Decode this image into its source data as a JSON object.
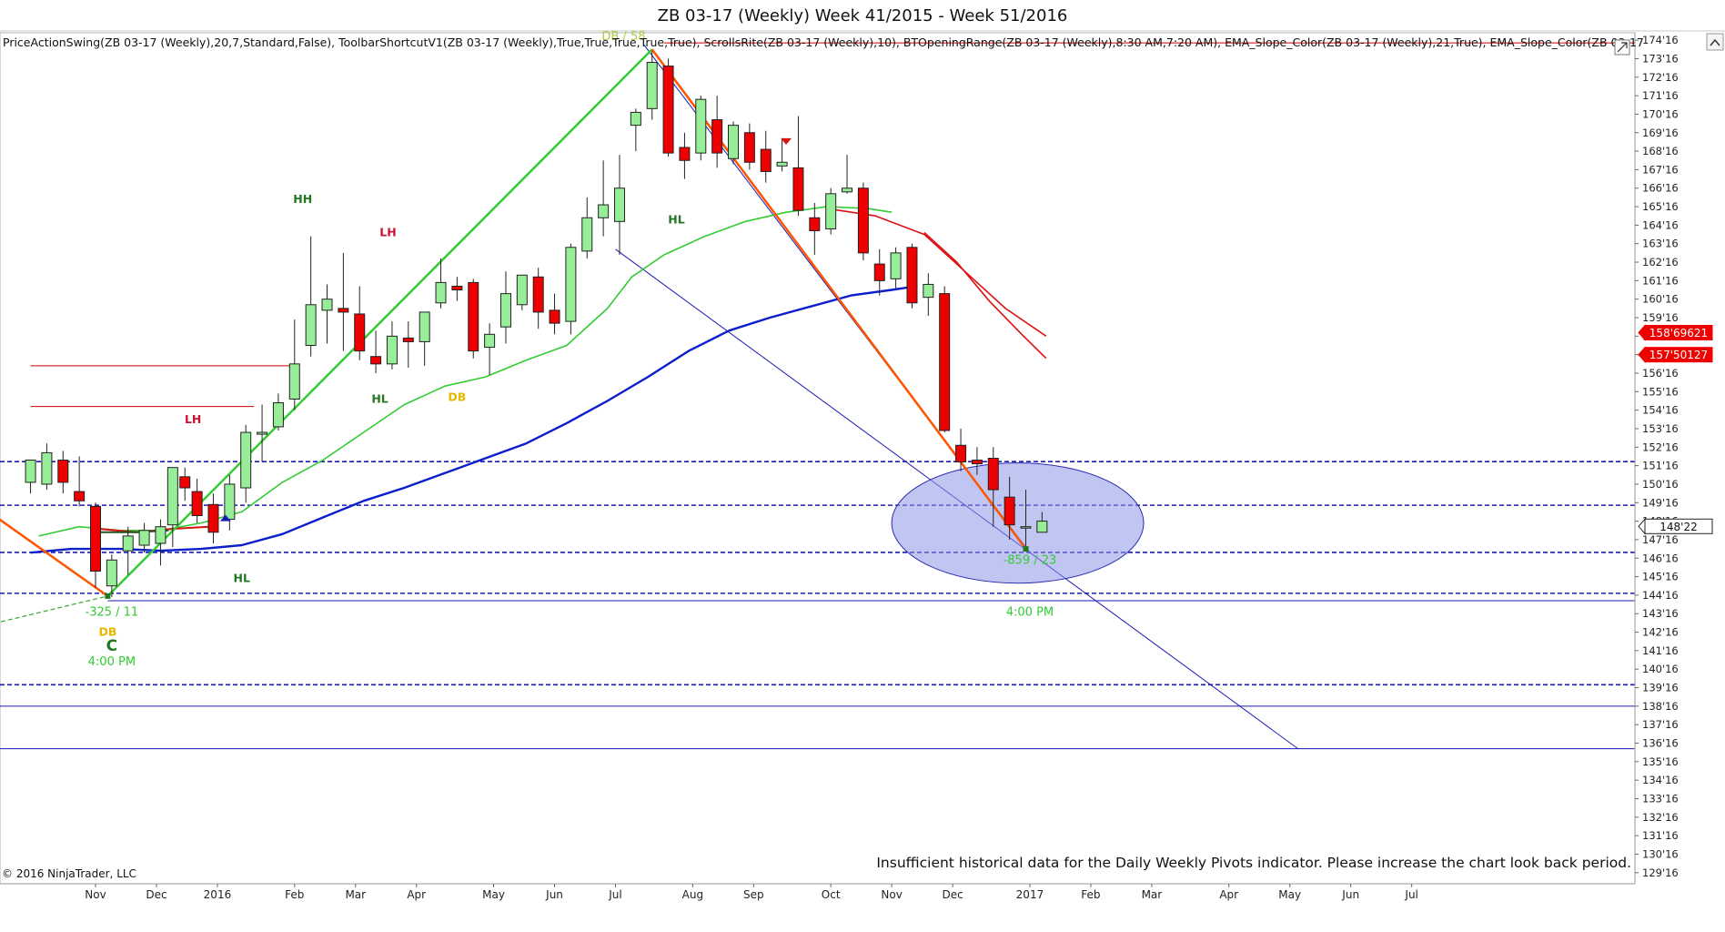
{
  "window": {
    "title": "ZB 03-17 (Weekly)  Week 41/2015 - Week 51/2016",
    "indicators_line": "PriceActionSwing(ZB 03-17 (Weekly),20,7,Standard,False), ToolbarShortcutV1(ZB 03-17 (Weekly),True,True,True,True,True), ScrollsRite(ZB 03-17 (Weekly),10), BTOpeningRange(ZB 03-17 (Weekly),8:30 AM,7:20 AM), EMA_Slope_Color(ZB 03-17 (Weekly),21,True), EMA_Slope_Color(ZB 03-17",
    "copyright": "© 2016 NinjaTrader, LLC",
    "warning": "Insufficient historical data for the Daily Weekly Pivots indicator. Please increase the chart look back period."
  },
  "colors": {
    "bull_candle": "#98ee98",
    "bear_candle": "#ee0000",
    "ema_fast": "#33cc33",
    "ema_slow": "#0a1ecc",
    "ema_red": "#dd1111",
    "swing_up": "#33cc33",
    "swing_down": "#ff5500",
    "levels": "#1a1ab4",
    "ellipse_fill": "#8c96e6"
  },
  "chart_data": {
    "type": "candlestick",
    "title": "ZB 03-17 (Weekly)  Week 41/2015 - Week 51/2016",
    "y_ticks": [
      "174'16",
      "173'16",
      "172'16",
      "171'16",
      "170'16",
      "169'16",
      "168'16",
      "167'16",
      "166'16",
      "165'16",
      "164'16",
      "163'16",
      "162'16",
      "161'16",
      "160'16",
      "159'16",
      "158'16",
      "157'16",
      "156'16",
      "155'16",
      "154'16",
      "153'16",
      "152'16",
      "151'16",
      "150'16",
      "149'16",
      "148'16",
      "147'16",
      "146'16",
      "145'16",
      "144'16",
      "143'16",
      "142'16",
      "141'16",
      "140'16",
      "139'16",
      "138'16",
      "137'16",
      "136'16",
      "135'16",
      "134'16",
      "133'16",
      "132'16",
      "131'16",
      "130'16",
      "129'16"
    ],
    "y_range": [
      128.9,
      174.9
    ],
    "x_ticks": [
      {
        "label": "Nov",
        "x": 0
      },
      {
        "label": "Dec",
        "x": 0.75
      },
      {
        "label": "2016",
        "x": 1.5
      },
      {
        "label": "Feb",
        "x": 2.45
      },
      {
        "label": "Mar",
        "x": 3.2
      },
      {
        "label": "Apr",
        "x": 3.95
      },
      {
        "label": "May",
        "x": 4.9
      },
      {
        "label": "Jun",
        "x": 5.65
      },
      {
        "label": "Jul",
        "x": 6.4
      },
      {
        "label": "Aug",
        "x": 7.35
      },
      {
        "label": "Sep",
        "x": 8.1
      },
      {
        "label": "Oct",
        "x": 9.05
      },
      {
        "label": "Nov",
        "x": 9.8
      },
      {
        "label": "Dec",
        "x": 10.55
      },
      {
        "label": "2017",
        "x": 11.5
      },
      {
        "label": "Feb",
        "x": 12.25
      },
      {
        "label": "Mar",
        "x": 13.0
      },
      {
        "label": "Apr",
        "x": 13.95
      },
      {
        "label": "May",
        "x": 14.7
      },
      {
        "label": "Jun",
        "x": 15.45
      },
      {
        "label": "Jul",
        "x": 16.2
      }
    ],
    "x_unit": "months from Nov 2015",
    "candles": [
      {
        "x": -0.8,
        "o": 150.6,
        "h": 151.3,
        "c": 151.8,
        "l": 150.0
      },
      {
        "x": -0.6,
        "o": 150.5,
        "h": 152.7,
        "c": 152.2,
        "l": 150.2
      },
      {
        "x": -0.4,
        "o": 151.8,
        "h": 152.3,
        "c": 150.6,
        "l": 150.0
      },
      {
        "x": -0.2,
        "o": 150.1,
        "h": 152.0,
        "c": 149.6,
        "l": 149.3
      },
      {
        "x": 0.0,
        "o": 149.3,
        "h": 149.5,
        "c": 145.8,
        "l": 144.9
      },
      {
        "x": 0.2,
        "o": 145.0,
        "h": 146.7,
        "c": 146.4,
        "l": 144.4
      },
      {
        "x": 0.4,
        "o": 146.9,
        "h": 148.2,
        "c": 147.7,
        "l": 145.6
      },
      {
        "x": 0.6,
        "o": 147.2,
        "h": 148.4,
        "c": 148.0,
        "l": 146.8
      },
      {
        "x": 0.8,
        "o": 147.3,
        "h": 148.6,
        "c": 148.2,
        "l": 146.1
      },
      {
        "x": 0.95,
        "o": 148.3,
        "h": 151.3,
        "c": 151.4,
        "l": 147.1
      },
      {
        "x": 1.1,
        "o": 150.9,
        "h": 151.4,
        "c": 150.3,
        "l": 149.6
      },
      {
        "x": 1.25,
        "o": 150.1,
        "h": 150.8,
        "c": 148.8,
        "l": 148.4
      },
      {
        "x": 1.45,
        "o": 149.4,
        "h": 150.0,
        "c": 147.9,
        "l": 147.3
      },
      {
        "x": 1.65,
        "o": 148.6,
        "h": 151.0,
        "c": 150.5,
        "l": 148.0
      },
      {
        "x": 1.85,
        "o": 150.3,
        "h": 153.7,
        "c": 153.3,
        "l": 149.5
      },
      {
        "x": 2.05,
        "o": 153.2,
        "h": 154.8,
        "c": 153.3,
        "l": 151.7
      },
      {
        "x": 2.25,
        "o": 153.6,
        "h": 155.4,
        "c": 154.9,
        "l": 153.4
      },
      {
        "x": 2.45,
        "o": 155.1,
        "h": 159.4,
        "c": 157.0,
        "l": 154.5
      },
      {
        "x": 2.65,
        "o": 158.0,
        "h": 163.9,
        "c": 160.2,
        "l": 157.4
      },
      {
        "x": 2.85,
        "o": 159.9,
        "h": 161.3,
        "c": 160.5,
        "l": 158.1
      },
      {
        "x": 3.05,
        "o": 160.0,
        "h": 163.0,
        "c": 159.8,
        "l": 157.7
      },
      {
        "x": 3.25,
        "o": 159.7,
        "h": 161.2,
        "c": 157.7,
        "l": 157.2
      },
      {
        "x": 3.45,
        "o": 157.4,
        "h": 158.8,
        "c": 157.0,
        "l": 156.5
      },
      {
        "x": 3.65,
        "o": 157.0,
        "h": 159.3,
        "c": 158.5,
        "l": 156.7
      },
      {
        "x": 3.85,
        "o": 158.4,
        "h": 159.3,
        "c": 158.2,
        "l": 156.8
      },
      {
        "x": 4.05,
        "o": 158.2,
        "h": 159.7,
        "c": 159.8,
        "l": 156.9
      },
      {
        "x": 4.25,
        "o": 160.3,
        "h": 162.7,
        "c": 161.4,
        "l": 160.0
      },
      {
        "x": 4.45,
        "o": 161.2,
        "h": 161.7,
        "c": 161.0,
        "l": 160.4
      },
      {
        "x": 4.65,
        "o": 161.4,
        "h": 161.6,
        "c": 157.7,
        "l": 157.3
      },
      {
        "x": 4.85,
        "o": 157.9,
        "h": 159.2,
        "c": 158.6,
        "l": 156.4
      },
      {
        "x": 5.05,
        "o": 159.0,
        "h": 162.0,
        "c": 160.8,
        "l": 158.1
      },
      {
        "x": 5.25,
        "o": 160.2,
        "h": 161.8,
        "c": 161.8,
        "l": 159.9
      },
      {
        "x": 5.45,
        "o": 161.7,
        "h": 162.2,
        "c": 159.8,
        "l": 158.9
      },
      {
        "x": 5.65,
        "o": 159.9,
        "h": 160.8,
        "c": 159.2,
        "l": 158.6
      },
      {
        "x": 5.85,
        "o": 159.3,
        "h": 163.5,
        "c": 163.3,
        "l": 158.6
      },
      {
        "x": 6.05,
        "o": 163.1,
        "h": 166.0,
        "c": 164.9,
        "l": 162.7
      },
      {
        "x": 6.25,
        "o": 164.9,
        "h": 168.0,
        "c": 165.6,
        "l": 163.9
      },
      {
        "x": 6.45,
        "o": 164.7,
        "h": 168.3,
        "c": 166.5,
        "l": 162.9
      },
      {
        "x": 6.65,
        "o": 169.9,
        "h": 170.8,
        "c": 170.6,
        "l": 168.5
      },
      {
        "x": 6.85,
        "o": 170.8,
        "h": 173.9,
        "c": 173.3,
        "l": 170.2
      },
      {
        "x": 7.05,
        "o": 173.1,
        "h": 173.5,
        "c": 168.4,
        "l": 168.2
      },
      {
        "x": 7.25,
        "o": 168.7,
        "h": 169.5,
        "c": 168.0,
        "l": 167.0
      },
      {
        "x": 7.45,
        "o": 168.4,
        "h": 171.5,
        "c": 171.3,
        "l": 168.0
      },
      {
        "x": 7.65,
        "o": 170.2,
        "h": 171.5,
        "c": 168.4,
        "l": 167.6
      },
      {
        "x": 7.85,
        "o": 168.1,
        "h": 170.1,
        "c": 169.9,
        "l": 167.8
      },
      {
        "x": 8.05,
        "o": 169.5,
        "h": 170.0,
        "c": 167.9,
        "l": 167.5
      },
      {
        "x": 8.25,
        "o": 168.6,
        "h": 169.6,
        "c": 167.4,
        "l": 166.8
      },
      {
        "x": 8.45,
        "o": 167.7,
        "h": 169.2,
        "c": 167.9,
        "l": 167.4
      },
      {
        "x": 8.65,
        "o": 167.6,
        "h": 170.4,
        "c": 165.3,
        "l": 165.0
      },
      {
        "x": 8.85,
        "o": 164.9,
        "h": 165.7,
        "c": 164.2,
        "l": 162.9
      },
      {
        "x": 9.05,
        "o": 164.3,
        "h": 166.5,
        "c": 166.2,
        "l": 164.0
      },
      {
        "x": 9.25,
        "o": 166.3,
        "h": 168.3,
        "c": 166.5,
        "l": 166.2
      },
      {
        "x": 9.45,
        "o": 166.5,
        "h": 166.8,
        "c": 163.0,
        "l": 162.6
      },
      {
        "x": 9.65,
        "o": 162.4,
        "h": 163.2,
        "c": 161.5,
        "l": 160.7
      },
      {
        "x": 9.85,
        "o": 161.6,
        "h": 163.3,
        "c": 163.0,
        "l": 161.1
      },
      {
        "x": 10.05,
        "o": 163.3,
        "h": 163.5,
        "c": 160.3,
        "l": 160.0
      },
      {
        "x": 10.25,
        "o": 160.6,
        "h": 161.9,
        "c": 161.3,
        "l": 159.6
      },
      {
        "x": 10.45,
        "o": 160.8,
        "h": 161.2,
        "c": 153.4,
        "l": 153.3
      },
      {
        "x": 10.65,
        "o": 152.6,
        "h": 153.5,
        "c": 151.7,
        "l": 151.2
      },
      {
        "x": 10.85,
        "o": 151.8,
        "h": 152.5,
        "c": 151.6,
        "l": 151.0
      },
      {
        "x": 11.05,
        "o": 151.9,
        "h": 152.5,
        "c": 150.2,
        "l": 148.2
      },
      {
        "x": 11.25,
        "o": 149.8,
        "h": 150.9,
        "c": 148.3,
        "l": 147.5
      },
      {
        "x": 11.45,
        "o": 148.2,
        "h": 150.2,
        "c": 148.2,
        "l": 147.0
      },
      {
        "x": 11.65,
        "o": 147.9,
        "h": 149.0,
        "c": 148.5,
        "l": 148.0
      }
    ],
    "horizontal_lines": [
      {
        "y": 174.35,
        "color": "#cc0000",
        "style": "solid",
        "x_from": 7.0
      },
      {
        "y": 156.9,
        "color": "#cc0000",
        "style": "solid",
        "x_from": -0.8,
        "x_to": 2.5
      },
      {
        "y": 154.7,
        "color": "#cc0000",
        "style": "solid",
        "x_from": -0.8,
        "x_to": 1.95
      },
      {
        "y": 151.72,
        "color": "#1a1ab4",
        "style": "dashed"
      },
      {
        "y": 149.36,
        "color": "#1a1ab4",
        "style": "dashed"
      },
      {
        "y": 146.81,
        "color": "#1a1ab4",
        "style": "dashed"
      },
      {
        "y": 144.6,
        "color": "#1a1ab4",
        "style": "dashed"
      },
      {
        "y": 144.2,
        "color": "#1a1ab4",
        "style": "solid",
        "x_from": 0.15
      },
      {
        "y": 139.66,
        "color": "#1a1ab4",
        "style": "dashed"
      },
      {
        "y": 138.5,
        "color": "#1a1ab4",
        "style": "solid"
      },
      {
        "y": 136.2,
        "color": "#1a1ab4",
        "style": "solid"
      }
    ],
    "trend_lines": [
      {
        "x1": 6.75,
        "y1": 174.25,
        "x2": 11.5,
        "y2": 146.8,
        "color": "#1a1ab4",
        "width": 1
      },
      {
        "x1": 6.4,
        "y1": 163.2,
        "x2": 14.8,
        "y2": 136.2,
        "color": "#1a1ab4",
        "width": 1
      }
    ],
    "swing_lines": [
      {
        "points": [
          [
            -1.6,
            149.9
          ],
          [
            0.15,
            144.45
          ]
        ],
        "color": "#ff5500",
        "width": 2.5
      },
      {
        "points": [
          [
            0.15,
            144.45
          ],
          [
            6.85,
            174.0
          ]
        ],
        "color": "#33cc33",
        "width": 2.5
      },
      {
        "points": [
          [
            6.85,
            174.0
          ],
          [
            11.45,
            147.0
          ]
        ],
        "color": "#ff5500",
        "width": 2.5
      },
      {
        "points": [
          [
            -1.6,
            142.6
          ],
          [
            0.15,
            144.45
          ]
        ],
        "color": "#33aa33",
        "width": 1.2,
        "dashed": true
      }
    ],
    "ema_fast": {
      "color": "#33cc33",
      "points": [
        [
          -0.7,
          147.7
        ],
        [
          -0.2,
          148.2
        ],
        [
          0.3,
          148.0
        ],
        [
          0.8,
          148.0
        ],
        [
          1.3,
          148.4
        ],
        [
          1.8,
          149.0
        ],
        [
          2.3,
          150.6
        ],
        [
          2.8,
          151.8
        ],
        [
          3.3,
          153.3
        ],
        [
          3.8,
          154.8
        ],
        [
          4.3,
          155.8
        ],
        [
          4.8,
          156.3
        ],
        [
          5.3,
          157.2
        ],
        [
          5.8,
          158.0
        ],
        [
          6.3,
          160.0
        ],
        [
          6.6,
          161.7
        ],
        [
          7.0,
          162.9
        ],
        [
          7.5,
          163.9
        ],
        [
          8.0,
          164.7
        ],
        [
          8.5,
          165.2
        ],
        [
          9.0,
          165.5
        ],
        [
          9.5,
          165.4
        ],
        [
          9.8,
          165.2
        ]
      ]
    },
    "ema_slow": {
      "color": "#0a1ecc",
      "points": [
        [
          -0.8,
          146.8
        ],
        [
          -0.3,
          147.0
        ],
        [
          0.3,
          147.0
        ],
        [
          0.8,
          146.9
        ],
        [
          1.3,
          147.0
        ],
        [
          1.8,
          147.2
        ],
        [
          2.3,
          147.8
        ],
        [
          2.8,
          148.7
        ],
        [
          3.3,
          149.6
        ],
        [
          3.8,
          150.3
        ],
        [
          4.3,
          151.1
        ],
        [
          4.8,
          151.9
        ],
        [
          5.3,
          152.7
        ],
        [
          5.8,
          153.8
        ],
        [
          6.3,
          155.0
        ],
        [
          6.8,
          156.3
        ],
        [
          7.3,
          157.7
        ],
        [
          7.8,
          158.8
        ],
        [
          8.3,
          159.5
        ],
        [
          8.8,
          160.1
        ],
        [
          9.3,
          160.7
        ],
        [
          9.8,
          161.0
        ],
        [
          10.1,
          161.2
        ]
      ]
    },
    "ema_red_right": {
      "color": "#dd1111",
      "points": [
        [
          9.0,
          165.4
        ],
        [
          9.6,
          165.0
        ],
        [
          10.2,
          164.0
        ],
        [
          10.7,
          162.0
        ],
        [
          11.2,
          160.0
        ],
        [
          11.7,
          158.5
        ]
      ]
    },
    "ema_red_right2": {
      "color": "#dd1111",
      "points": [
        [
          10.2,
          164.1
        ],
        [
          10.6,
          162.5
        ],
        [
          11.0,
          160.4
        ],
        [
          11.4,
          158.6
        ],
        [
          11.7,
          157.3
        ]
      ]
    },
    "ema_red_left": {
      "color": "#dd1111",
      "points": [
        [
          0.0,
          148.1
        ],
        [
          0.5,
          147.9
        ],
        [
          1.0,
          148.1
        ],
        [
          1.4,
          148.2
        ]
      ]
    },
    "ema_dark_left": {
      "color": "#225522",
      "points": [
        [
          0.0,
          147.9
        ],
        [
          0.5,
          147.9
        ],
        [
          0.9,
          148.0
        ]
      ]
    },
    "labels": [
      {
        "text": "HH",
        "x": 2.55,
        "y": 165.7,
        "color": "#227722"
      },
      {
        "text": "LH",
        "x": 3.6,
        "y": 163.9,
        "color": "#cc1133"
      },
      {
        "text": "HL",
        "x": 7.15,
        "y": 164.6,
        "color": "#227722"
      },
      {
        "text": "HL",
        "x": 3.5,
        "y": 154.9,
        "color": "#227722"
      },
      {
        "text": "DB",
        "x": 4.45,
        "y": 155.0,
        "color": "#e6b800"
      },
      {
        "text": "LH",
        "x": 1.2,
        "y": 153.8,
        "color": "#cc1133"
      },
      {
        "text": "HL",
        "x": 1.8,
        "y": 145.2,
        "color": "#227722"
      },
      {
        "text": "DB",
        "x": 0.15,
        "y": 142.3,
        "color": "#e6b800"
      },
      {
        "text": "DB / 58",
        "x": 6.5,
        "y": 174.5,
        "color": "#aacc44"
      },
      {
        "text": "-325 / 11",
        "x": 0.2,
        "y": 143.4,
        "color": "#33cc33"
      },
      {
        "text": "-859 / 23",
        "x": 11.5,
        "y": 146.2,
        "color": "#33cc33"
      },
      {
        "text": "4:00 PM",
        "x": 0.2,
        "y": 140.7,
        "color": "#33cc33"
      },
      {
        "text": "4:00 PM",
        "x": 11.5,
        "y": 143.4,
        "color": "#33cc33"
      },
      {
        "text": "C",
        "x": 0.2,
        "y": 141.5,
        "color": "#227722"
      }
    ],
    "price_tags": [
      {
        "text": "158'69621",
        "y": 158.69,
        "color": "#ee0000"
      },
      {
        "text": "157'50127",
        "y": 157.5,
        "color": "#ee0000"
      },
      {
        "text": "148'22",
        "y": 148.22,
        "color": "#111111"
      }
    ],
    "ellipse": {
      "cx": 11.35,
      "cy": 148.4,
      "rx": 1.55,
      "ry": 3.25
    }
  }
}
